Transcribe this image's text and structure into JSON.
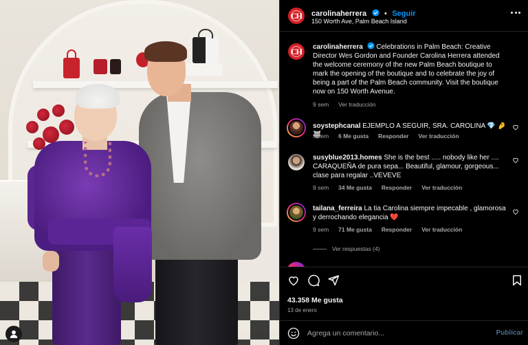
{
  "post": {
    "author": {
      "username": "carolinaherrera",
      "avatar_initials": "CH",
      "verified": true
    },
    "follow_label": "Seguir",
    "location": "150 Worth Ave, Palm Beach Island",
    "caption": "Celebrations in Palm Beach: Creative Director Wes Gordon and Founder Carolina Herrera attended the welcome ceremony of the new Palm Beach boutique to mark the opening of the boutique and to celebrate the joy of being a part of the Palm Beach community. Visit the boutique now on 150 Worth Avenue.",
    "caption_time": "9 sem",
    "see_translation": "Ver traducción",
    "likes": "43.358 Me gusta",
    "date": "13 de enero"
  },
  "comments": [
    {
      "username": "soystephcanal",
      "text": "EJEMPLO A SEGUIR, SRA. CAROLINA 💎 🤌 🐺",
      "time": "9 sem",
      "likes": "6 Me gusta",
      "reply": "Responder",
      "translate": "Ver traducción"
    },
    {
      "username": "susyblue2013.homes",
      "text": "She is the best ..... nobody like her .... CARAQUEÑA de pura sepa... Beautiful, glamour, gorgeous... clase para regalar ..VEVEVE",
      "time": "9 sem",
      "likes": "34 Me gusta",
      "reply": "Responder",
      "translate": "Ver traducción"
    },
    {
      "username": "tailana_ferreira",
      "text": "La tia Carolina siempre impecable , glamorosa y derrochando elegancia ❤️",
      "time": "9 sem",
      "likes": "71 Me gusta",
      "reply": "Responder",
      "translate": "Ver traducción"
    }
  ],
  "view_replies": "Ver respuestas (4)",
  "composer": {
    "placeholder": "Agrega un comentario...",
    "publish": "Publicar"
  },
  "colors": {
    "background": "#000000",
    "accent_blue": "#0095f6",
    "brand_red": "#d61f26",
    "muted_text": "#a8a8a8",
    "heart_red": "#ed4956"
  },
  "icons": [
    "verified-icon",
    "more-icon",
    "heart-icon",
    "comment-icon",
    "share-icon",
    "save-icon",
    "emoji-icon",
    "profile-icon"
  ]
}
